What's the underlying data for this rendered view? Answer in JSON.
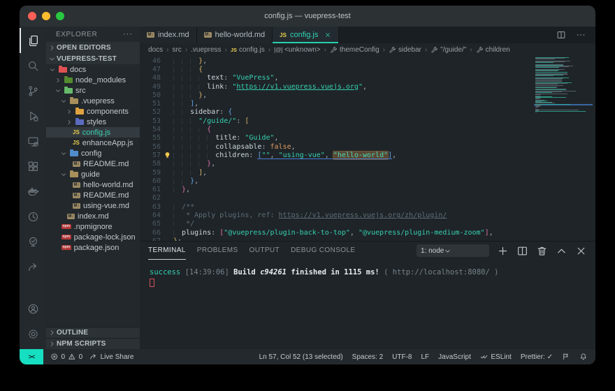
{
  "theme": {
    "accent": "#26cfae",
    "traffic_lights": [
      "#ff5f57",
      "#febc2e",
      "#28c840"
    ]
  },
  "window": {
    "title": "config.js — vuepress-test"
  },
  "icon_text": {
    "js": "JS",
    "md": "M↓",
    "npm": "npm",
    "symbol": "[@]"
  },
  "activity_bar": {
    "top": [
      "explorer",
      "search",
      "source-control",
      "run-debug",
      "remote-explorer",
      "extensions",
      "docker",
      "clock",
      "approvals",
      "live-share"
    ],
    "bottom": [
      "account",
      "settings"
    ],
    "active": "explorer"
  },
  "sidebar": {
    "title": "EXPLORER",
    "more": "···",
    "open_editors": "OPEN EDITORS",
    "root": "VUEPRESS-TEST",
    "tree": [
      {
        "label": "docs",
        "kind": "folder",
        "color": "#e05252",
        "indent": 0,
        "chev": "open"
      },
      {
        "label": "node_modules",
        "kind": "folder",
        "color": "#558b2f",
        "indent": 1,
        "chev": "closed"
      },
      {
        "label": "src",
        "kind": "folder",
        "color": "#66bb6a",
        "indent": 1,
        "chev": "open"
      },
      {
        "label": ".vuepress",
        "kind": "folder",
        "color": "#a98f5c",
        "indent": 2,
        "chev": "open"
      },
      {
        "label": "components",
        "kind": "folder",
        "color": "#e0a23f",
        "indent": 3,
        "chev": "closed"
      },
      {
        "label": "styles",
        "kind": "folder",
        "color": "#5c6bc0",
        "indent": 3,
        "chev": "closed"
      },
      {
        "label": "config.js",
        "kind": "js",
        "indent": 3,
        "selected": true
      },
      {
        "label": "enhanceApp.js",
        "kind": "js",
        "indent": 3
      },
      {
        "label": "config",
        "kind": "folder",
        "color": "#4f8cc9",
        "indent": 2,
        "chev": "open"
      },
      {
        "label": "README.md",
        "kind": "md",
        "indent": 3
      },
      {
        "label": "guide",
        "kind": "folder",
        "color": "#a98f5c",
        "indent": 2,
        "chev": "open"
      },
      {
        "label": "hello-world.md",
        "kind": "md",
        "indent": 3
      },
      {
        "label": "README.md",
        "kind": "md",
        "indent": 3
      },
      {
        "label": "using-vue.md",
        "kind": "md",
        "indent": 3
      },
      {
        "label": "index.md",
        "kind": "md",
        "indent": 2
      },
      {
        "label": ".npmignore",
        "kind": "npm",
        "indent": 1
      },
      {
        "label": "package-lock.json",
        "kind": "npm",
        "indent": 1
      },
      {
        "label": "package.json",
        "kind": "npm",
        "indent": 1
      }
    ],
    "bottom_sections": [
      "OUTLINE",
      "NPM SCRIPTS"
    ]
  },
  "editor_tabs": {
    "tabs": [
      {
        "label": "index.md",
        "icon": "md",
        "active": false
      },
      {
        "label": "hello-world.md",
        "icon": "md",
        "active": false
      },
      {
        "label": "config.js",
        "icon": "js",
        "active": true
      }
    ],
    "actions": [
      "split-editor",
      "more"
    ]
  },
  "breadcrumb": [
    {
      "label": "docs"
    },
    {
      "label": "src"
    },
    {
      "label": ".vuepress"
    },
    {
      "label": "config.js",
      "icon": "js"
    },
    {
      "label": "<unknown>",
      "icon": "symbol"
    },
    {
      "label": "themeConfig",
      "icon": "wrench"
    },
    {
      "label": "sidebar",
      "icon": "wrench"
    },
    {
      "label": "\"/guide/\"",
      "icon": "wrench"
    },
    {
      "label": "children",
      "icon": "wrench"
    }
  ],
  "editor": {
    "lightbulb_line": 57,
    "selection_line": 57,
    "total_lines": 67,
    "lines": [
      {
        "n": 46,
        "tokens": [
          {
            "c": "w",
            "t": "      "
          },
          {
            "c": "g",
            "t": "}"
          },
          {
            "c": "p",
            "t": ","
          }
        ]
      },
      {
        "n": 47,
        "tokens": [
          {
            "c": "w",
            "t": "      "
          },
          {
            "c": "g",
            "t": "{"
          }
        ]
      },
      {
        "n": 48,
        "tokens": [
          {
            "c": "w",
            "t": "        "
          },
          {
            "c": "k",
            "t": "text"
          },
          {
            "c": "p",
            "t": ": "
          },
          {
            "c": "s",
            "t": "\"VuePress\""
          },
          {
            "c": "p",
            "t": ","
          }
        ]
      },
      {
        "n": 49,
        "tokens": [
          {
            "c": "w",
            "t": "        "
          },
          {
            "c": "k",
            "t": "link"
          },
          {
            "c": "p",
            "t": ": "
          },
          {
            "c": "s",
            "t": "\""
          },
          {
            "c": "su",
            "t": "https://v1.vuepress.vuejs.org"
          },
          {
            "c": "s",
            "t": "\""
          },
          {
            "c": "p",
            "t": ","
          }
        ]
      },
      {
        "n": 50,
        "tokens": [
          {
            "c": "w",
            "t": "      "
          },
          {
            "c": "g",
            "t": "}"
          },
          {
            "c": "p",
            "t": ","
          }
        ]
      },
      {
        "n": 51,
        "tokens": [
          {
            "c": "w",
            "t": "    "
          },
          {
            "c": "b",
            "t": "]"
          },
          {
            "c": "p",
            "t": ","
          }
        ]
      },
      {
        "n": 52,
        "tokens": [
          {
            "c": "w",
            "t": "    "
          },
          {
            "c": "k",
            "t": "sidebar"
          },
          {
            "c": "p",
            "t": ": "
          },
          {
            "c": "b",
            "t": "{"
          }
        ]
      },
      {
        "n": 53,
        "tokens": [
          {
            "c": "w",
            "t": "      "
          },
          {
            "c": "s",
            "t": "\"/guide/\""
          },
          {
            "c": "p",
            "t": ": "
          },
          {
            "c": "g",
            "t": "["
          }
        ]
      },
      {
        "n": 54,
        "tokens": [
          {
            "c": "w",
            "t": "        "
          },
          {
            "c": "m",
            "t": "{"
          }
        ]
      },
      {
        "n": 55,
        "tokens": [
          {
            "c": "w",
            "t": "          "
          },
          {
            "c": "k",
            "t": "title"
          },
          {
            "c": "p",
            "t": ": "
          },
          {
            "c": "s",
            "t": "\"Guide\""
          },
          {
            "c": "p",
            "t": ","
          }
        ]
      },
      {
        "n": 56,
        "tokens": [
          {
            "c": "w",
            "t": "          "
          },
          {
            "c": "k",
            "t": "collapsable"
          },
          {
            "c": "p",
            "t": ": "
          },
          {
            "c": "o",
            "t": "false"
          },
          {
            "c": "p",
            "t": ","
          }
        ]
      },
      {
        "n": 57,
        "tokens": [
          {
            "c": "w",
            "t": "          "
          },
          {
            "c": "k",
            "t": "children"
          },
          {
            "c": "p",
            "t": ": "
          },
          {
            "c": "b u",
            "t": "["
          },
          {
            "c": "s u",
            "t": "\"\""
          },
          {
            "c": "p u",
            "t": ", "
          },
          {
            "c": "s u",
            "t": "\"using-vue\""
          },
          {
            "c": "p u",
            "t": ", "
          },
          {
            "c": "selx u",
            "t": "\"hello-world\""
          },
          {
            "c": "b u",
            "t": "]"
          },
          {
            "c": "p",
            "t": ","
          }
        ]
      },
      {
        "n": 58,
        "tokens": [
          {
            "c": "w",
            "t": "        "
          },
          {
            "c": "m",
            "t": "}"
          },
          {
            "c": "p",
            "t": ","
          }
        ]
      },
      {
        "n": 59,
        "tokens": [
          {
            "c": "w",
            "t": "      "
          },
          {
            "c": "g",
            "t": "]"
          },
          {
            "c": "p",
            "t": ","
          }
        ]
      },
      {
        "n": 60,
        "tokens": [
          {
            "c": "w",
            "t": "    "
          },
          {
            "c": "b",
            "t": "}"
          },
          {
            "c": "p",
            "t": ","
          }
        ]
      },
      {
        "n": 61,
        "tokens": [
          {
            "c": "w",
            "t": "  "
          },
          {
            "c": "m",
            "t": "}"
          },
          {
            "c": "p",
            "t": ","
          }
        ]
      },
      {
        "n": 62,
        "tokens": []
      },
      {
        "n": 63,
        "tokens": [
          {
            "c": "w",
            "t": "  "
          },
          {
            "c": "c",
            "t": "/**"
          }
        ]
      },
      {
        "n": 64,
        "tokens": [
          {
            "c": "w",
            "t": "  "
          },
          {
            "c": "c",
            "t": " * Apply plugins, ref: "
          },
          {
            "c": "cu",
            "t": "https://v1.vuepress.vuejs.org/zh/plugin/"
          }
        ]
      },
      {
        "n": 65,
        "tokens": [
          {
            "c": "w",
            "t": "  "
          },
          {
            "c": "c",
            "t": " */"
          }
        ]
      },
      {
        "n": 66,
        "tokens": [
          {
            "c": "w",
            "t": "  "
          },
          {
            "c": "k",
            "t": "plugins"
          },
          {
            "c": "p",
            "t": ": "
          },
          {
            "c": "m",
            "t": "["
          },
          {
            "c": "s",
            "t": "\"@vuepress/plugin-back-to-top\""
          },
          {
            "c": "p",
            "t": ", "
          },
          {
            "c": "s",
            "t": "\"@vuepress/plugin-medium-zoom\""
          },
          {
            "c": "m",
            "t": "]"
          },
          {
            "c": "p",
            "t": ","
          }
        ]
      },
      {
        "n": 67,
        "tokens": [
          {
            "c": "g",
            "t": "}"
          },
          {
            "c": "p",
            "t": ";"
          }
        ]
      }
    ]
  },
  "panel": {
    "tabs": [
      {
        "label": "TERMINAL",
        "active": true
      },
      {
        "label": "PROBLEMS",
        "active": false
      },
      {
        "label": "OUTPUT",
        "active": false
      },
      {
        "label": "DEBUG CONSOLE",
        "active": false
      }
    ],
    "dropdown": "1: node",
    "actions": [
      "plus",
      "split",
      "trash",
      "chevron-up",
      "close"
    ],
    "output_tokens": [
      {
        "t": "success",
        "c": "ok"
      },
      {
        "t": " [14:39:06] ",
        "c": "d"
      },
      {
        "t": "Build ",
        "c": "b"
      },
      {
        "t": "c94261",
        "c": "bi"
      },
      {
        "t": " finished in 1115 ms!",
        "c": "b"
      },
      {
        "t": " ( http://localhost:8080/ )",
        "c": "d"
      }
    ]
  },
  "status_bar": {
    "remote": "><",
    "errors": "0",
    "warnings": "0",
    "live_share": "Live Share",
    "right": [
      {
        "text": "Ln 57, Col 52 (13 selected)"
      },
      {
        "text": "Spaces: 2"
      },
      {
        "text": "UTF-8"
      },
      {
        "text": "LF"
      },
      {
        "text": "JavaScript"
      },
      {
        "icon": "double-check",
        "text": "ESLint"
      },
      {
        "text": "Prettier: ✓"
      },
      {
        "icon": "feedback"
      },
      {
        "icon": "bell"
      }
    ]
  }
}
